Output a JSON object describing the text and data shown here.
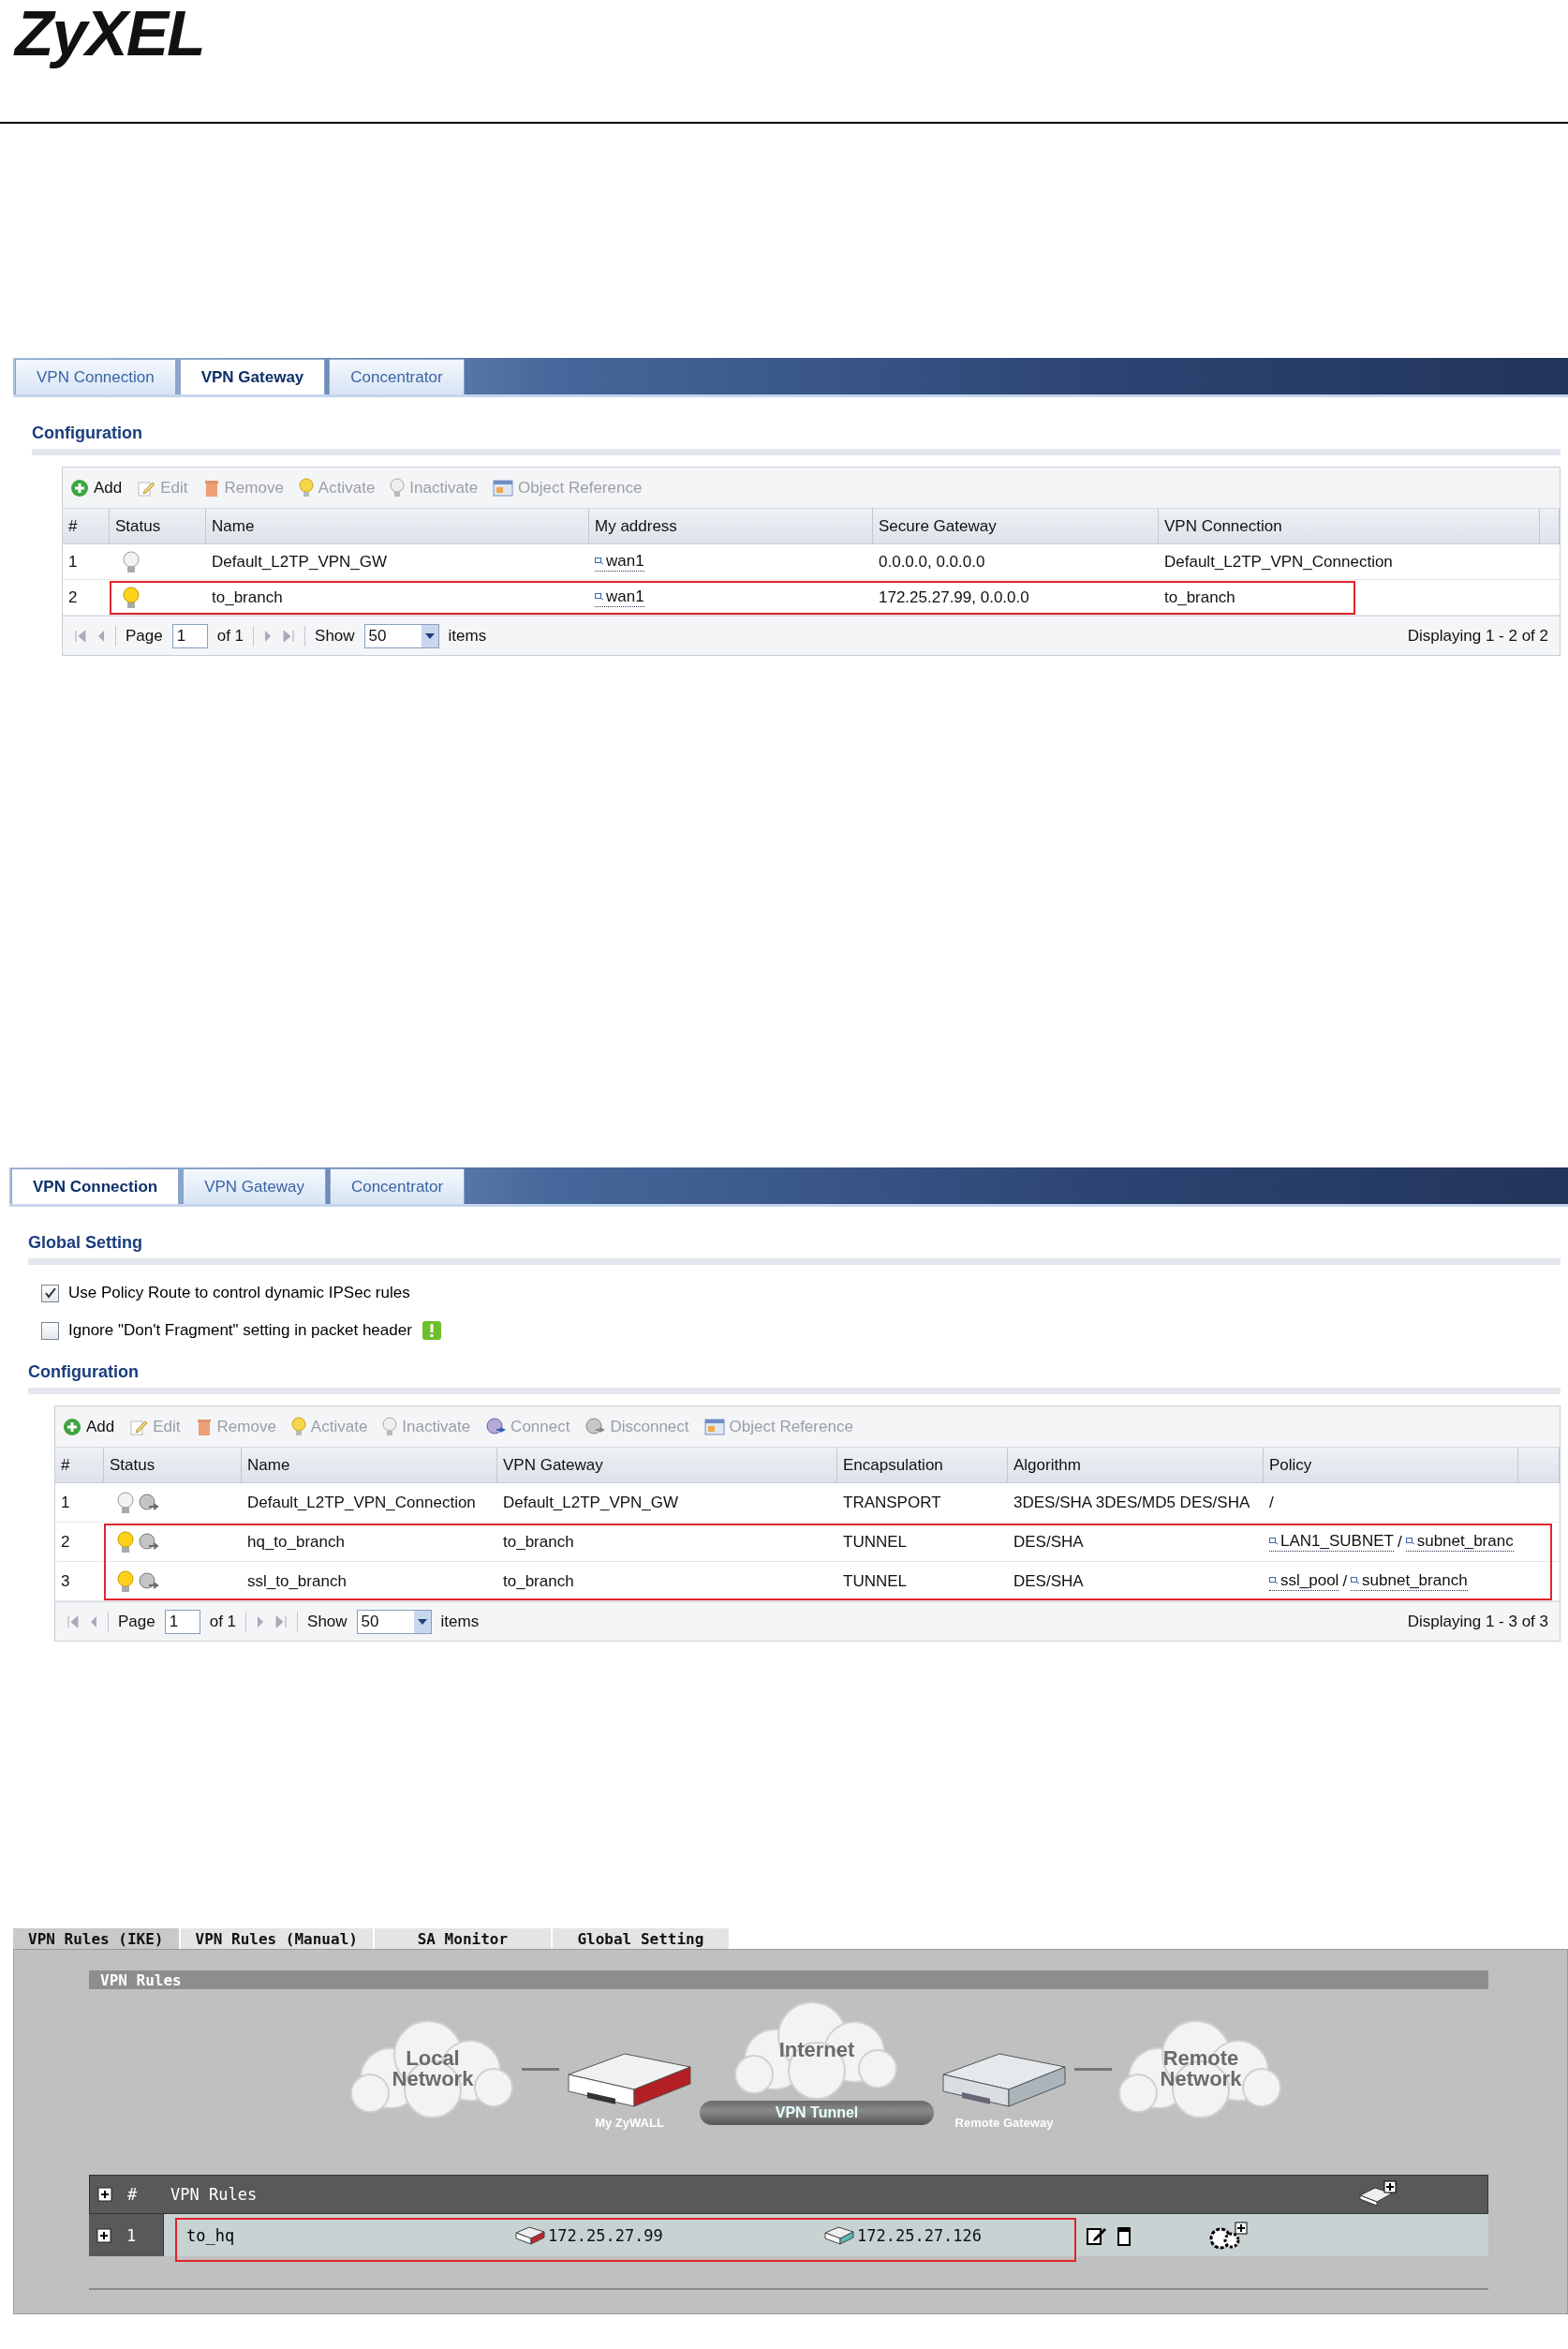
{
  "logo": "ZyXEL",
  "gateway_screen": {
    "tabs": [
      {
        "label": "VPN Connection",
        "selected": false
      },
      {
        "label": "VPN Gateway",
        "selected": true
      },
      {
        "label": "Concentrator",
        "selected": false
      }
    ],
    "section_title": "Configuration",
    "toolbar": [
      {
        "kind": "add",
        "label": "Add",
        "disabled": false
      },
      {
        "kind": "edit",
        "label": "Edit",
        "disabled": true
      },
      {
        "kind": "remove",
        "label": "Remove",
        "disabled": true
      },
      {
        "kind": "activate",
        "label": "Activate",
        "disabled": true
      },
      {
        "kind": "inactivate",
        "label": "Inactivate",
        "disabled": true
      },
      {
        "kind": "reference",
        "label": "Object Reference",
        "disabled": true
      }
    ],
    "columns": [
      "#",
      "Status",
      "Name",
      "My address",
      "Secure Gateway",
      "VPN Connection"
    ],
    "rows": [
      {
        "highlighted": false,
        "cells": [
          "1",
          {
            "active": false
          },
          "Default_L2TP_VPN_GW",
          [
            {
              "kind": "object",
              "text": "wan1"
            }
          ],
          "0.0.0.0, 0.0.0.0",
          "Default_L2TP_VPN_Connection"
        ]
      },
      {
        "highlighted": true,
        "cells": [
          "2",
          {
            "active": true
          },
          "to_branch",
          [
            {
              "kind": "object",
              "text": "wan1"
            }
          ],
          "172.25.27.99, 0.0.0.0",
          "to_branch"
        ]
      }
    ],
    "pager": {
      "page_label": "Page",
      "page": "1",
      "of": "of 1",
      "show_label": "Show",
      "show": "50",
      "items": "items",
      "display": "Displaying 1 - 2 of 2"
    }
  },
  "connection_screen": {
    "tabs": [
      {
        "label": "VPN Connection",
        "selected": true
      },
      {
        "label": "VPN Gateway",
        "selected": false
      },
      {
        "label": "Concentrator",
        "selected": false
      }
    ],
    "global_title": "Global Setting",
    "settings": [
      {
        "label": "Use Policy Route to control dynamic IPSec rules",
        "checked": true,
        "info": false
      },
      {
        "label": "Ignore \"Don't Fragment\" setting in packet header",
        "checked": false,
        "info": true
      }
    ],
    "section_title": "Configuration",
    "toolbar": [
      {
        "kind": "add",
        "label": "Add",
        "disabled": false
      },
      {
        "kind": "edit",
        "label": "Edit",
        "disabled": true
      },
      {
        "kind": "remove",
        "label": "Remove",
        "disabled": true
      },
      {
        "kind": "activate",
        "label": "Activate",
        "disabled": true
      },
      {
        "kind": "inactivate",
        "label": "Inactivate",
        "disabled": true
      },
      {
        "kind": "connect",
        "label": "Connect",
        "disabled": true
      },
      {
        "kind": "disconnect",
        "label": "Disconnect",
        "disabled": true
      },
      {
        "kind": "reference",
        "label": "Object Reference",
        "disabled": true
      }
    ],
    "columns": [
      "#",
      "Status",
      "Name",
      "VPN Gateway",
      "Encapsulation",
      "Algorithm",
      "Policy"
    ],
    "rows": [
      {
        "highlighted": false,
        "cells": [
          "1",
          {
            "active": false,
            "connected": false
          },
          "Default_L2TP_VPN_Connection",
          "Default_L2TP_VPN_GW",
          "TRANSPORT",
          "3DES/SHA 3DES/MD5 DES/SHA",
          "/"
        ]
      },
      {
        "highlighted": true,
        "cells": [
          "2",
          {
            "active": true,
            "connected": false
          },
          "hq_to_branch",
          "to_branch",
          "TUNNEL",
          "DES/SHA",
          [
            {
              "kind": "object",
              "text": "LAN1_SUBNET"
            },
            {
              "kind": "plain",
              "text": "/"
            },
            {
              "kind": "object",
              "text": "subnet_branc"
            }
          ]
        ]
      },
      {
        "highlighted": true,
        "cells": [
          "3",
          {
            "active": true,
            "connected": false
          },
          "ssl_to_branch",
          "to_branch",
          "TUNNEL",
          "DES/SHA",
          [
            {
              "kind": "object",
              "text": "ssl_pool"
            },
            {
              "kind": "plain",
              "text": "/"
            },
            {
              "kind": "object",
              "text": "subnet_branch"
            }
          ]
        ]
      }
    ],
    "pager": {
      "page_label": "Page",
      "page": "1",
      "of": "of 1",
      "show_label": "Show",
      "show": "50",
      "items": "items",
      "display": "Displaying 1 - 3 of 3"
    }
  },
  "rules_screen": {
    "tabs": [
      {
        "label": "VPN Rules (IKE)",
        "selected": true
      },
      {
        "label": "VPN Rules (Manual)",
        "selected": false
      },
      {
        "label": "SA Monitor",
        "selected": false
      },
      {
        "label": "Global Setting",
        "selected": false
      }
    ],
    "section_title": "VPN Rules",
    "diagram": {
      "local": "Local Network",
      "internet": "Internet",
      "tunnel": "VPN Tunnel",
      "my_device": "My ZyWALL",
      "remote_device": "Remote Gateway",
      "remote": "Remote Network"
    },
    "table": {
      "number_header": "#",
      "title": "VPN Rules",
      "rows": [
        {
          "number": "1",
          "name": "to_hq",
          "local_gateway": "172.25.27.99",
          "remote_gateway": "172.25.27.126",
          "highlighted": true
        }
      ]
    }
  }
}
